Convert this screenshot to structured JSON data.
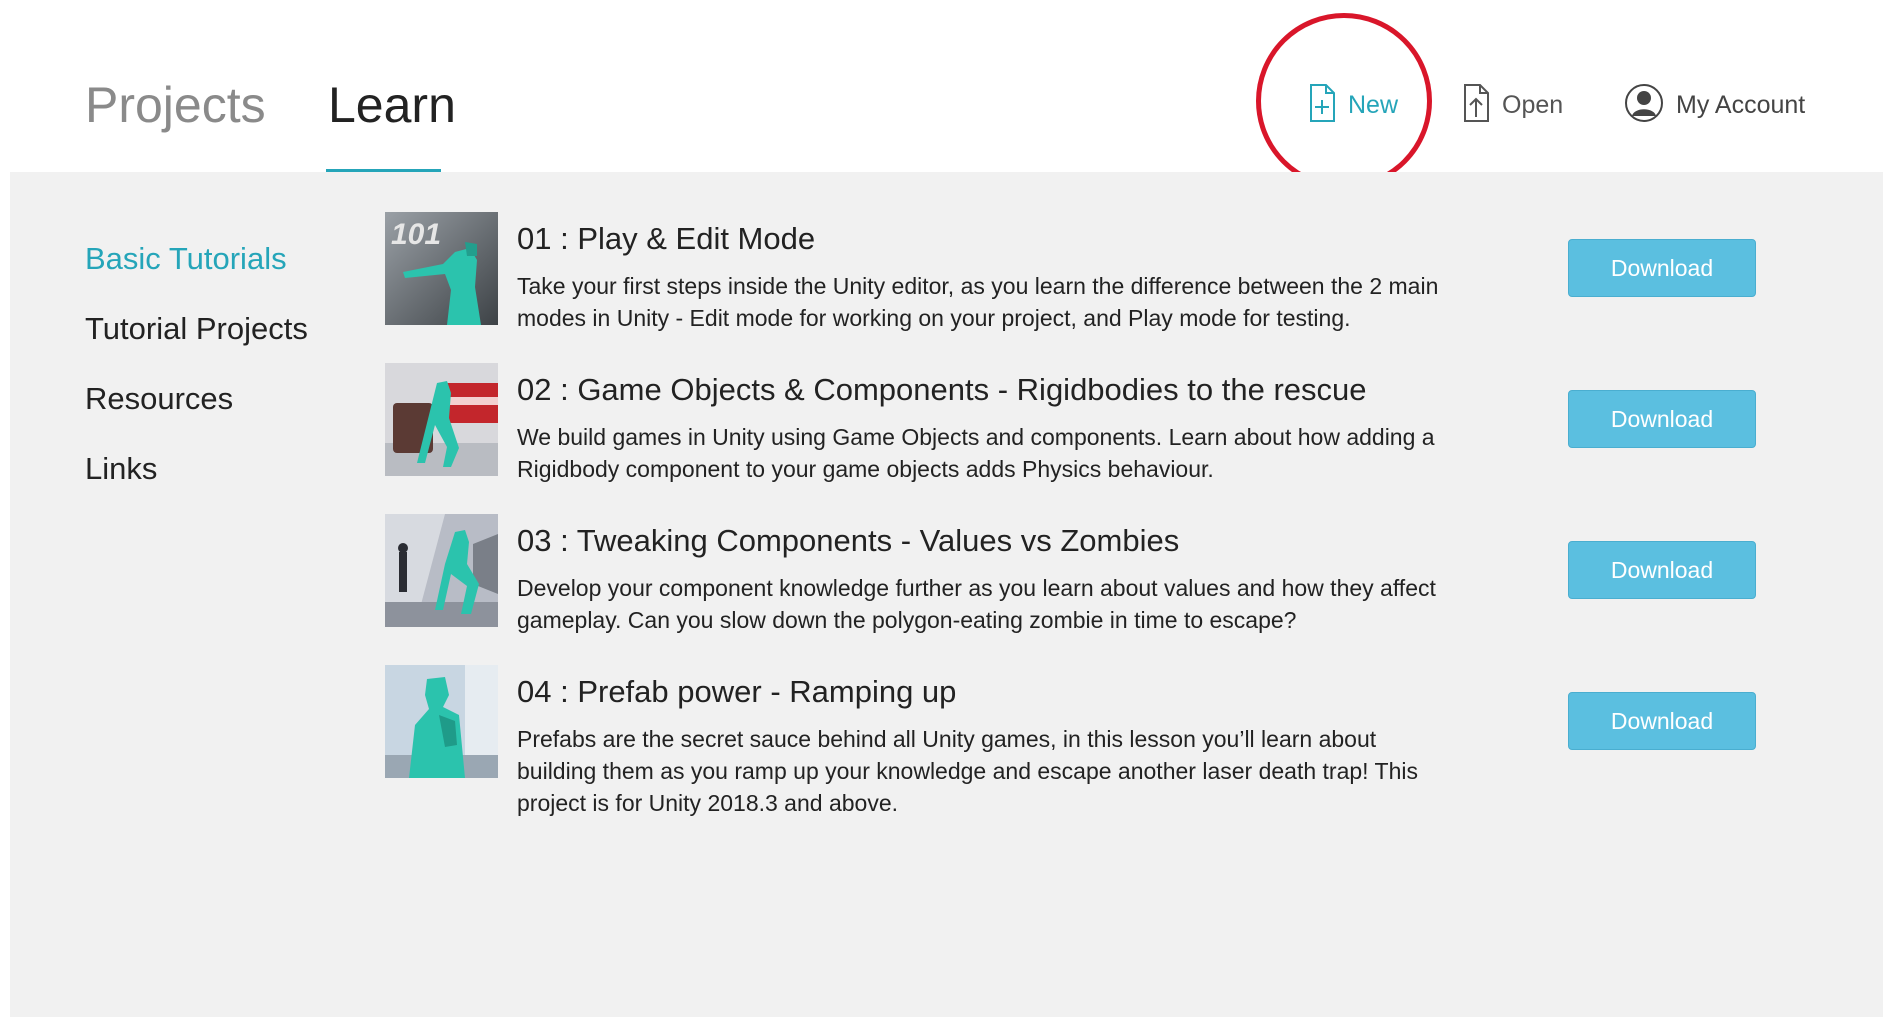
{
  "header": {
    "tabs": [
      {
        "label": "Projects",
        "active": false
      },
      {
        "label": "Learn",
        "active": true
      }
    ],
    "actions": {
      "new": {
        "label": "New",
        "icon": "new-file-icon"
      },
      "open": {
        "label": "Open",
        "icon": "open-file-icon"
      },
      "account": {
        "label": "My Account",
        "icon": "account-avatar-icon"
      }
    }
  },
  "sidebar": {
    "items": [
      {
        "label": "Basic Tutorials",
        "active": true
      },
      {
        "label": "Tutorial Projects",
        "active": false
      },
      {
        "label": "Resources",
        "active": false
      },
      {
        "label": "Links",
        "active": false
      }
    ]
  },
  "tutorials": [
    {
      "title": "01 : Play & Edit Mode",
      "description": "Take your first steps inside the Unity editor, as you learn the difference between the 2 main modes in Unity - Edit mode for working on your project, and Play mode for testing.",
      "thumb_text": "101",
      "button_label": "Download"
    },
    {
      "title": "02 : Game Objects & Components - Rigidbodies to the rescue",
      "description": "We build games in Unity using Game Objects and components. Learn about how adding a Rigidbody component to your game objects adds Physics behaviour.",
      "button_label": "Download"
    },
    {
      "title": "03 : Tweaking Components - Values vs Zombies",
      "description": "Develop your component knowledge further as you learn about values and how they affect gameplay. Can you slow down the polygon-eating zombie in time to escape?",
      "button_label": "Download"
    },
    {
      "title": "04 : Prefab power - Ramping up",
      "description": "Prefabs are the secret sauce behind all Unity games, in this lesson you’ll learn about building them as you ramp up your knowledge and escape another laser death trap! This project is for Unity 2018.3 and above.",
      "button_label": "Download"
    }
  ],
  "colors": {
    "accent": "#25a5b9",
    "button": "#5bbfe0",
    "highlight": "#d9162a",
    "content_bg": "#f1f1f1"
  }
}
